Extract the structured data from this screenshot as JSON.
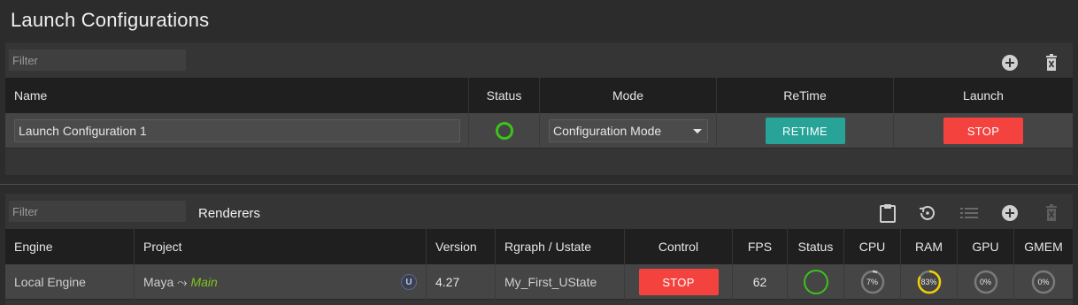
{
  "page": {
    "title": "Launch Configurations"
  },
  "launch": {
    "filter_placeholder": "Filter",
    "columns": [
      "Name",
      "Status",
      "Mode",
      "ReTime",
      "Launch"
    ],
    "rows": [
      {
        "name": "Launch Configuration 1",
        "status": "running",
        "mode": "Configuration Mode",
        "retime_label": "RETIME",
        "launch_label": "STOP"
      }
    ],
    "icons": [
      "add-icon",
      "delete-icon"
    ]
  },
  "renderers": {
    "filter_placeholder": "Filter",
    "label": "Renderers",
    "columns": [
      "Engine",
      "Project",
      "Version",
      "Rgraph / Ustate",
      "Control",
      "FPS",
      "Status",
      "CPU",
      "RAM",
      "GPU",
      "GMEM"
    ],
    "rows": [
      {
        "engine": "Local Engine",
        "project": "Maya",
        "project_arrow": "⤳",
        "project_branch": "Main",
        "version": "4.27",
        "rgraph": "My_First_UState",
        "control_label": "STOP",
        "fps": "62",
        "cpu": "7%",
        "cpu_value": 0.07,
        "ram": "83%",
        "ram_value": 0.83,
        "gpu": "0%",
        "gpu_value": 0,
        "gmem": "0%",
        "gmem_value": 0
      }
    ],
    "icons": [
      "clipboard-icon",
      "history-icon",
      "list-icon",
      "add-icon",
      "delete-icon"
    ]
  },
  "colors": {
    "status_ok": "#3cc318",
    "retime": "#27a398",
    "stop": "#f4433f",
    "branch": "#7fc31c",
    "cpu_gauge": "#c9c9c9",
    "ram_gauge": "#f0d000",
    "ram_gauge_2": "#3cc318"
  }
}
